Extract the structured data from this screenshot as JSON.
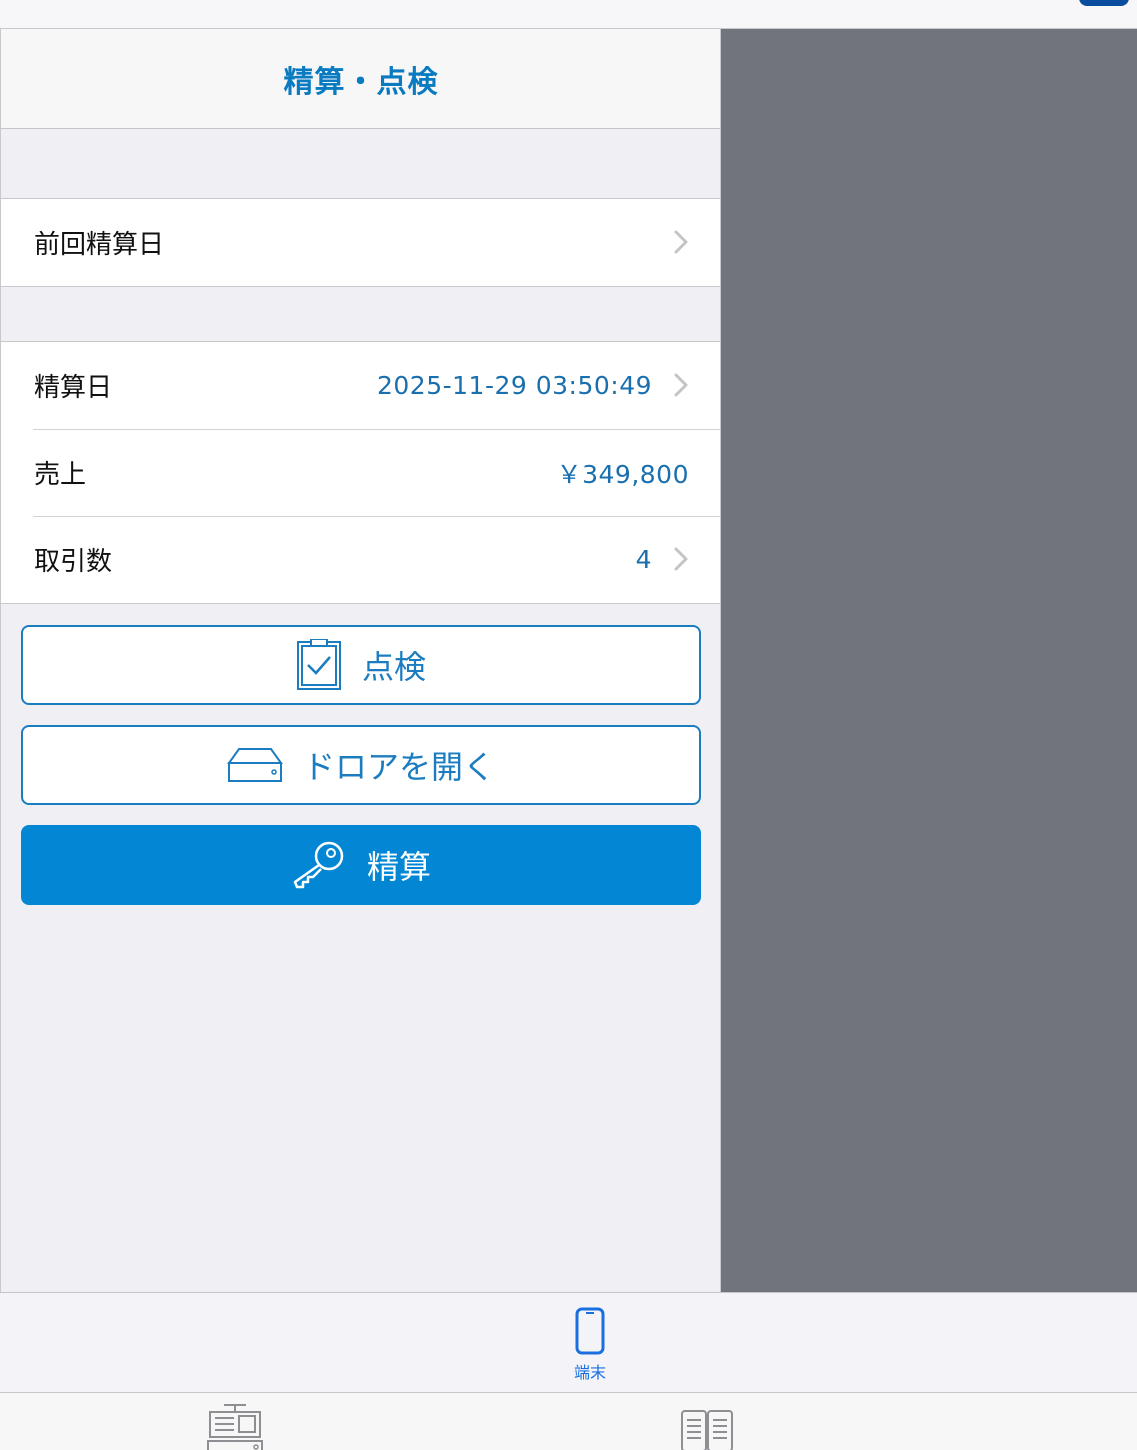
{
  "nav": {
    "title": "精算・点検"
  },
  "previous": {
    "label": "前回精算日"
  },
  "settlement": {
    "date_label": "精算日",
    "date_value": "2025-11-29 03:50:49",
    "sales_label": "売上",
    "sales_value": "￥349,800",
    "transactions_label": "取引数",
    "transactions_value": "4"
  },
  "buttons": {
    "inspect": "点検",
    "open_drawer": "ドロアを開く",
    "settle": "精算"
  },
  "tabbar": {
    "device_label": "端末"
  },
  "colors": {
    "accent": "#0387d4",
    "link_blue": "#1a6fae",
    "detail_pane": "#71747c",
    "tab_active": "#1a6fe0"
  },
  "icons": [
    "chevron-right-icon",
    "clipboard-check-icon",
    "drawer-icon",
    "key-icon",
    "smartphone-icon",
    "cash-register-icon",
    "ledger-icon"
  ]
}
